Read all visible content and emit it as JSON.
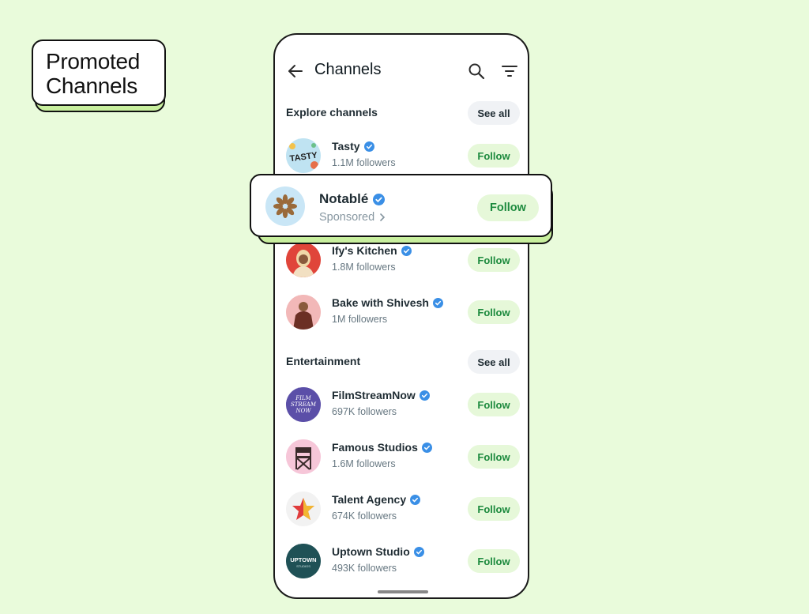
{
  "badge": {
    "line1": "Promoted",
    "line2": "Channels"
  },
  "header": {
    "title": "Channels"
  },
  "sections": [
    {
      "title": "Explore channels",
      "see_all": "See all"
    },
    {
      "title": "Entertainment",
      "see_all": "See all"
    }
  ],
  "follow_label": "Follow",
  "promoted": {
    "name": "Notablé",
    "subtitle": "Sponsored",
    "follow": "Follow"
  },
  "explore": [
    {
      "name": "Tasty",
      "followers": "1.1M followers",
      "avatar_text": "TASTY",
      "color": "#bfe3f2"
    },
    {
      "name": "Ify's Kitchen",
      "followers": "1.8M followers",
      "color": "#e0453a"
    },
    {
      "name": "Bake with Shivesh",
      "followers": "1M followers",
      "color": "#f2b8b8"
    }
  ],
  "entertainment": [
    {
      "name": "FilmStreamNow",
      "followers": "697K followers",
      "avatar_text": "FILM STREAM NOW",
      "color": "#5b4fa8"
    },
    {
      "name": "Famous Studios",
      "followers": "1.6M followers",
      "color": "#f6c6d8"
    },
    {
      "name": "Talent Agency",
      "followers": "674K followers",
      "color": "#f2f2f2"
    },
    {
      "name": "Uptown Studio",
      "followers": "493K followers",
      "avatar_text": "UPTOWN",
      "color": "#1f5156"
    }
  ],
  "colors": {
    "background": "#e9fbdb",
    "accent_green": "#1d8a3e",
    "verified_blue": "#3a8fe6"
  }
}
